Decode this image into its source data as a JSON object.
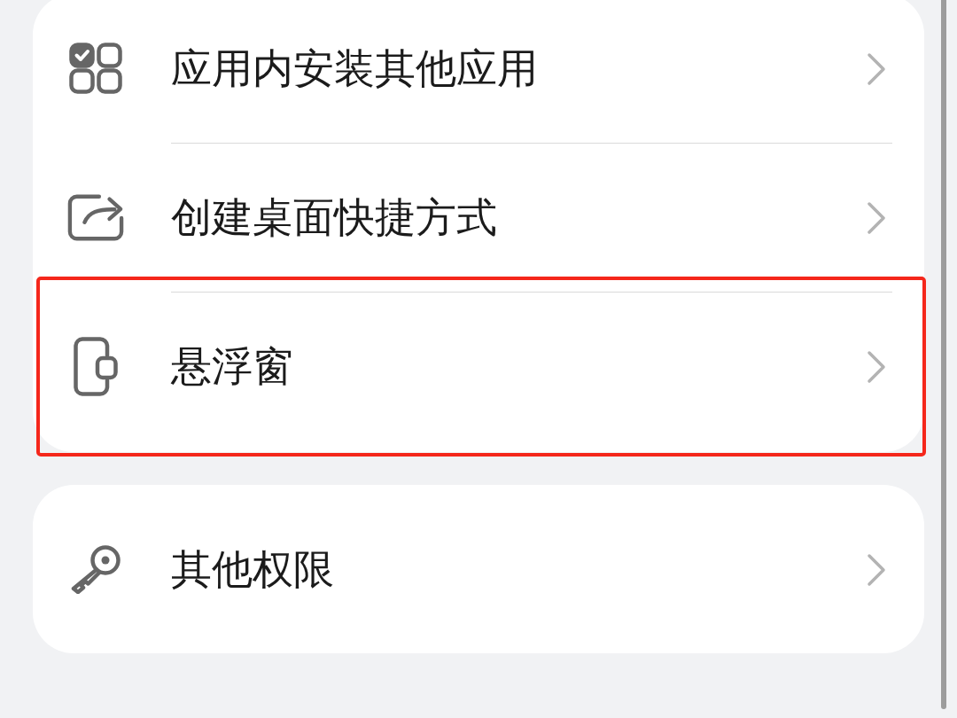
{
  "sections": [
    {
      "items": [
        {
          "label": "应用内安装其他应用",
          "kind": "apps",
          "highlighted": false
        },
        {
          "label": "创建桌面快捷方式",
          "kind": "shortcut",
          "highlighted": false
        },
        {
          "label": "悬浮窗",
          "kind": "floating",
          "highlighted": true
        }
      ]
    },
    {
      "items": [
        {
          "label": "其他权限",
          "kind": "key",
          "highlighted": false
        }
      ]
    }
  ]
}
